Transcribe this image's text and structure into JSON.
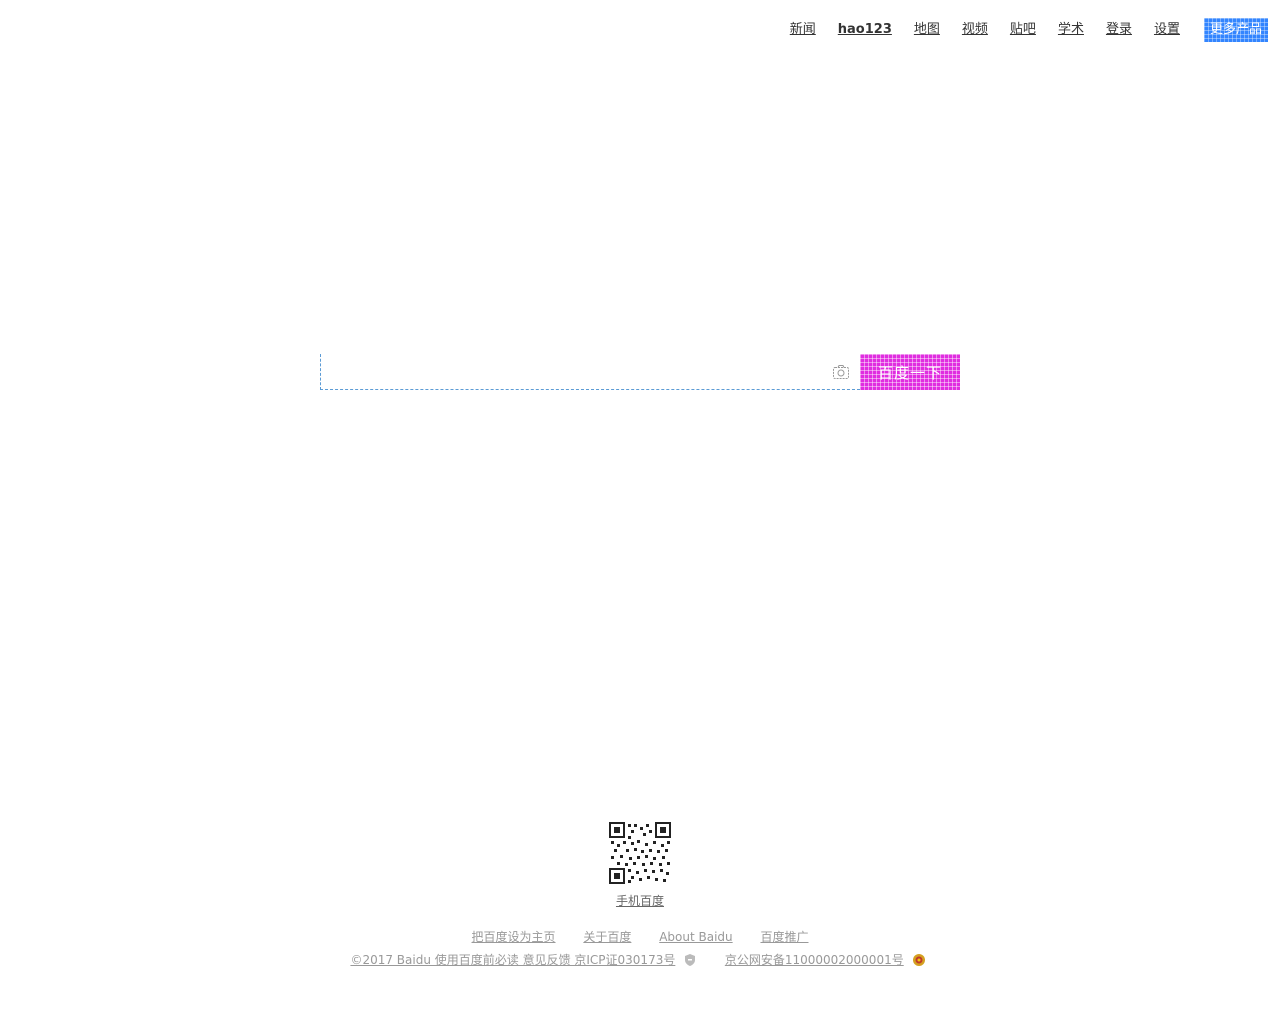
{
  "nav": {
    "links": [
      "新闻",
      "hao123",
      "地图",
      "视频",
      "贴吧",
      "学术",
      "登录",
      "设置"
    ],
    "more_label": "更多产品"
  },
  "search": {
    "value": "",
    "placeholder": "",
    "button_label": "百度一下"
  },
  "footer": {
    "qr_caption": "手机百度",
    "links": [
      "把百度设为主页",
      "关于百度",
      "About Baidu",
      "百度推广"
    ],
    "copyright": "©2017 Baidu 使用百度前必读 意见反馈 京ICP证030173号",
    "police_record": "京公网安备11000002000001号"
  },
  "colors": {
    "search_button": "#e02de0",
    "more_button": "#3385ff",
    "search_border": "#5b9bd5"
  }
}
